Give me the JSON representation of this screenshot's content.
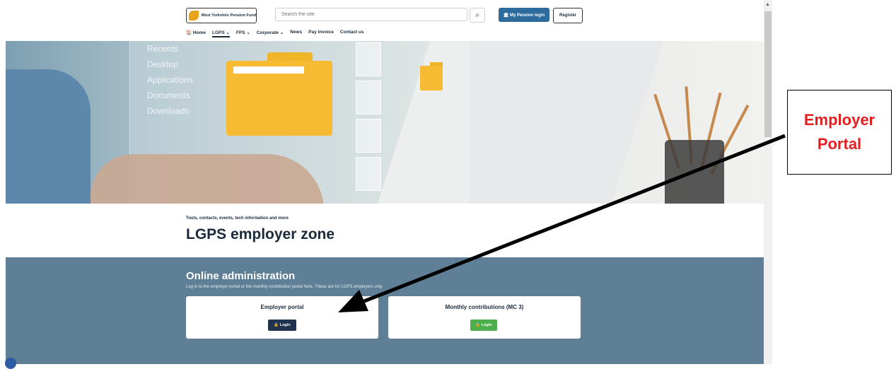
{
  "header": {
    "logo_text": "West Yorkshire Pension Fund",
    "search_placeholder": "Search the site",
    "search_icon": "search-icon",
    "pension_login": "🏛 My Pension login",
    "register": "Register"
  },
  "nav": {
    "home": "🏠 Home",
    "lgps": "LGPS ⌄",
    "fps": "FPS ⌄",
    "corporate": "Corporate ⌄",
    "news": "News",
    "pay_invoice": "Pay invoice",
    "contact": "Contact us"
  },
  "hero": {
    "menu_items": [
      "Recents",
      "Desktop",
      "Applications",
      "Documents",
      "Downloads"
    ]
  },
  "intro": {
    "eyebrow": "Tools, contacts, events, tech information and more",
    "title": "LGPS employer zone"
  },
  "admin": {
    "title": "Online administration",
    "subtitle": "Log in to the employer portal or the monthly contribution portal here. These are for LGPS employers only.",
    "cards": [
      {
        "title": "Employer portal",
        "button": "🔒 Login",
        "button_color": "#1f3350"
      },
      {
        "title": "Monthly contributions (MC 3)",
        "button": "🔒 Login",
        "button_color": "#4cae4c"
      }
    ]
  },
  "callout": {
    "line1": "Employer",
    "line2": "Portal",
    "color": "#e41e1e"
  }
}
